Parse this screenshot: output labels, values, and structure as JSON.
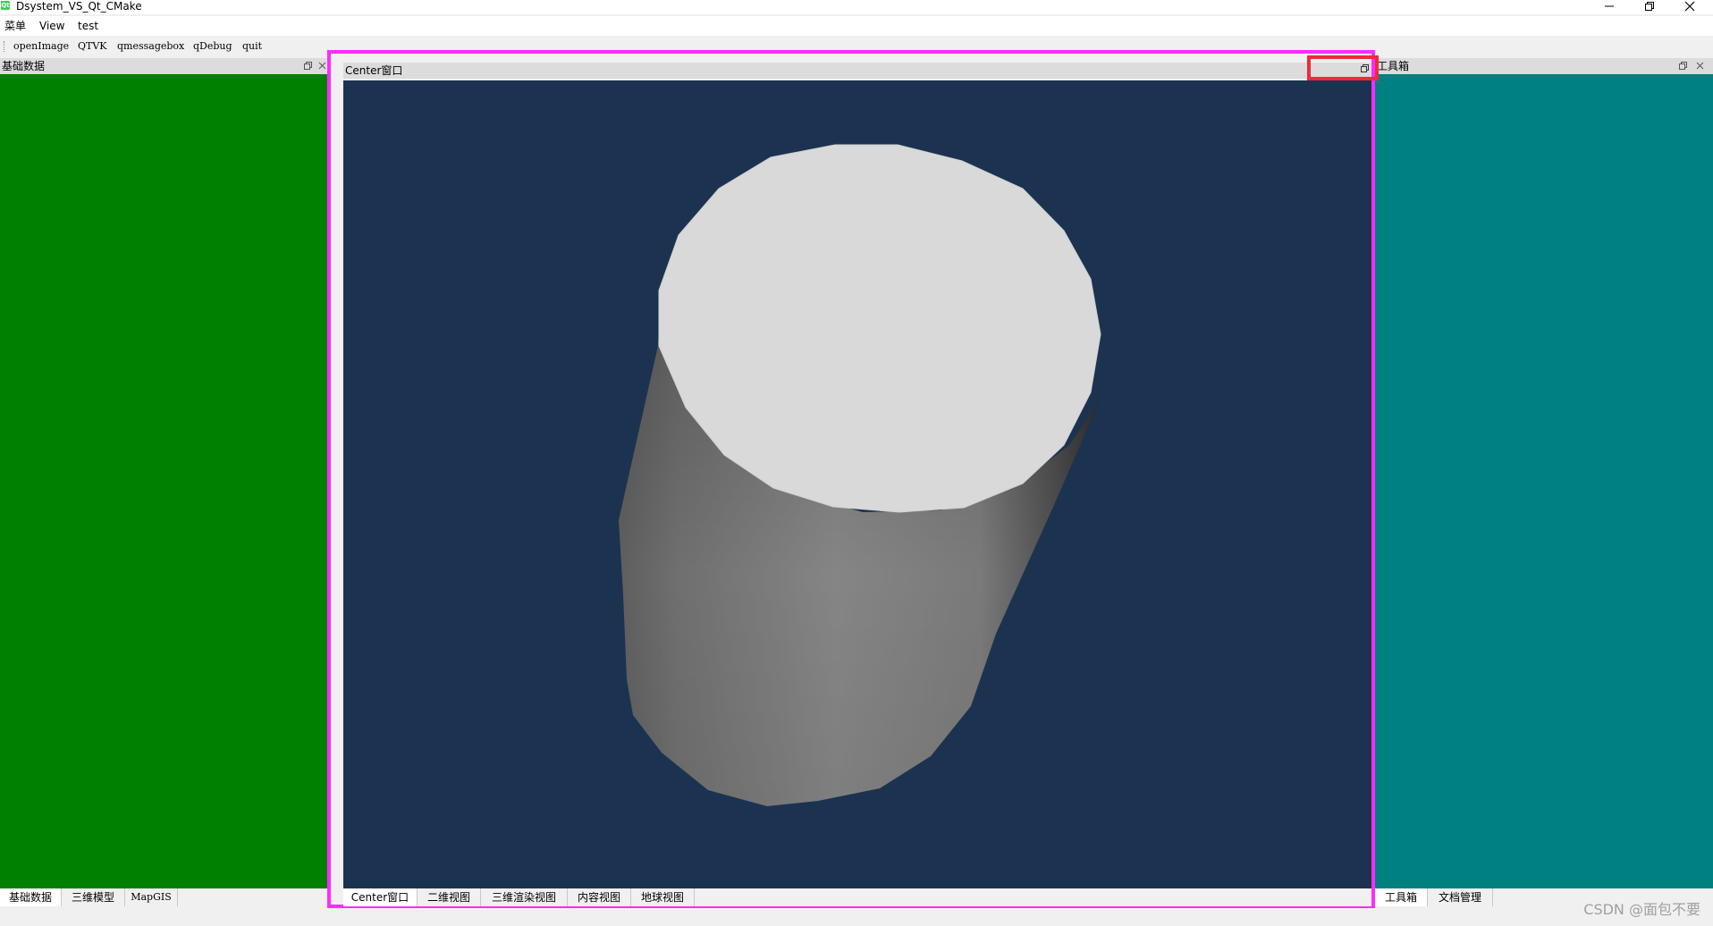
{
  "window": {
    "title": "Dsystem_VS_Qt_CMake",
    "app_icon_text": "Qt"
  },
  "menubar": {
    "items": [
      "菜单",
      "View",
      "test"
    ]
  },
  "toolbar": {
    "items": [
      "openImage",
      "QTVK",
      "qmessagebox",
      "qDebug",
      "quit"
    ]
  },
  "left_dock": {
    "title": "基础数据",
    "panel_color": "#008000",
    "tabs": [
      "基础数据",
      "三维模型",
      "MapGIS"
    ]
  },
  "center": {
    "title": "Center窗口",
    "viewport_color": "#1b3350",
    "scene_object": "cylinder",
    "tabs": [
      "Center窗口",
      "二维视图",
      "三维渲染视图",
      "内容视图",
      "地球视图"
    ],
    "highlight_frame_color": "#ff2aff",
    "highlight_button_color": "#ee2b3a"
  },
  "right_dock": {
    "title": "工具箱",
    "panel_color": "#008080",
    "tabs": [
      "工具箱",
      "文档管理"
    ]
  },
  "watermark": "CSDN @面包不要",
  "icons": {
    "minimize": "minimize-icon",
    "restore": "restore-icon",
    "close": "close-icon",
    "dock_float": "dock-float-icon",
    "dock_close": "dock-close-icon"
  }
}
